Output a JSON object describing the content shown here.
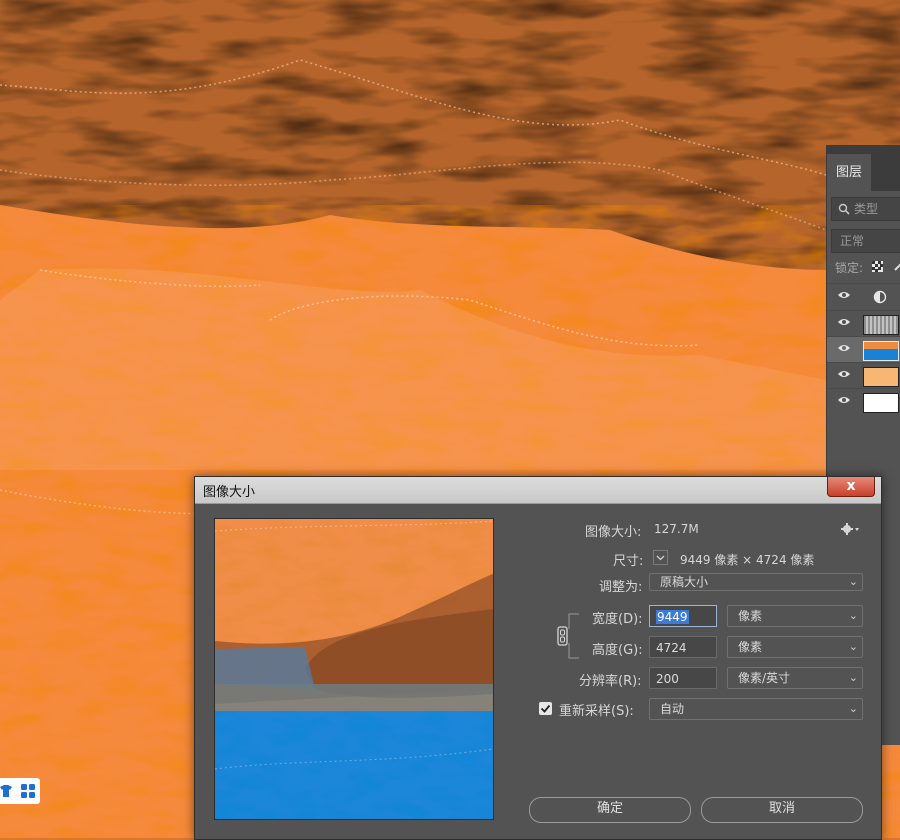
{
  "layers_panel": {
    "tab_label": "图层",
    "search_placeholder": "类型",
    "blend_mode": "正常",
    "lock_label": "锁定:",
    "layers": [
      {
        "thumbnail": "adjustment-icon"
      },
      {
        "thumbnail": "texture"
      },
      {
        "thumbnail": "orange-blue-image"
      },
      {
        "thumbnail": "fill-orange",
        "color": "#f7b774"
      },
      {
        "thumbnail": "fill-white",
        "color": "#ffffff"
      }
    ]
  },
  "dialog": {
    "title": "图像大小",
    "close_label": "x",
    "image_size_label": "图像大小:",
    "image_size_value": "127.7M",
    "dimensions_label": "尺寸:",
    "dimensions_value": "9449 像素  ×  4724 像素",
    "fit_to_label": "调整为:",
    "fit_to_value": "原稿大小",
    "width_label": "宽度(D):",
    "width_value": "9449",
    "width_unit": "像素",
    "height_label": "高度(G):",
    "height_value": "4724",
    "height_unit": "像素",
    "resolution_label": "分辨率(R):",
    "resolution_value": "200",
    "resolution_unit": "像素/英寸",
    "resample_label": "重新采样(S):",
    "resample_checked": true,
    "resample_value": "自动",
    "ok_label": "确定",
    "cancel_label": "取消"
  }
}
